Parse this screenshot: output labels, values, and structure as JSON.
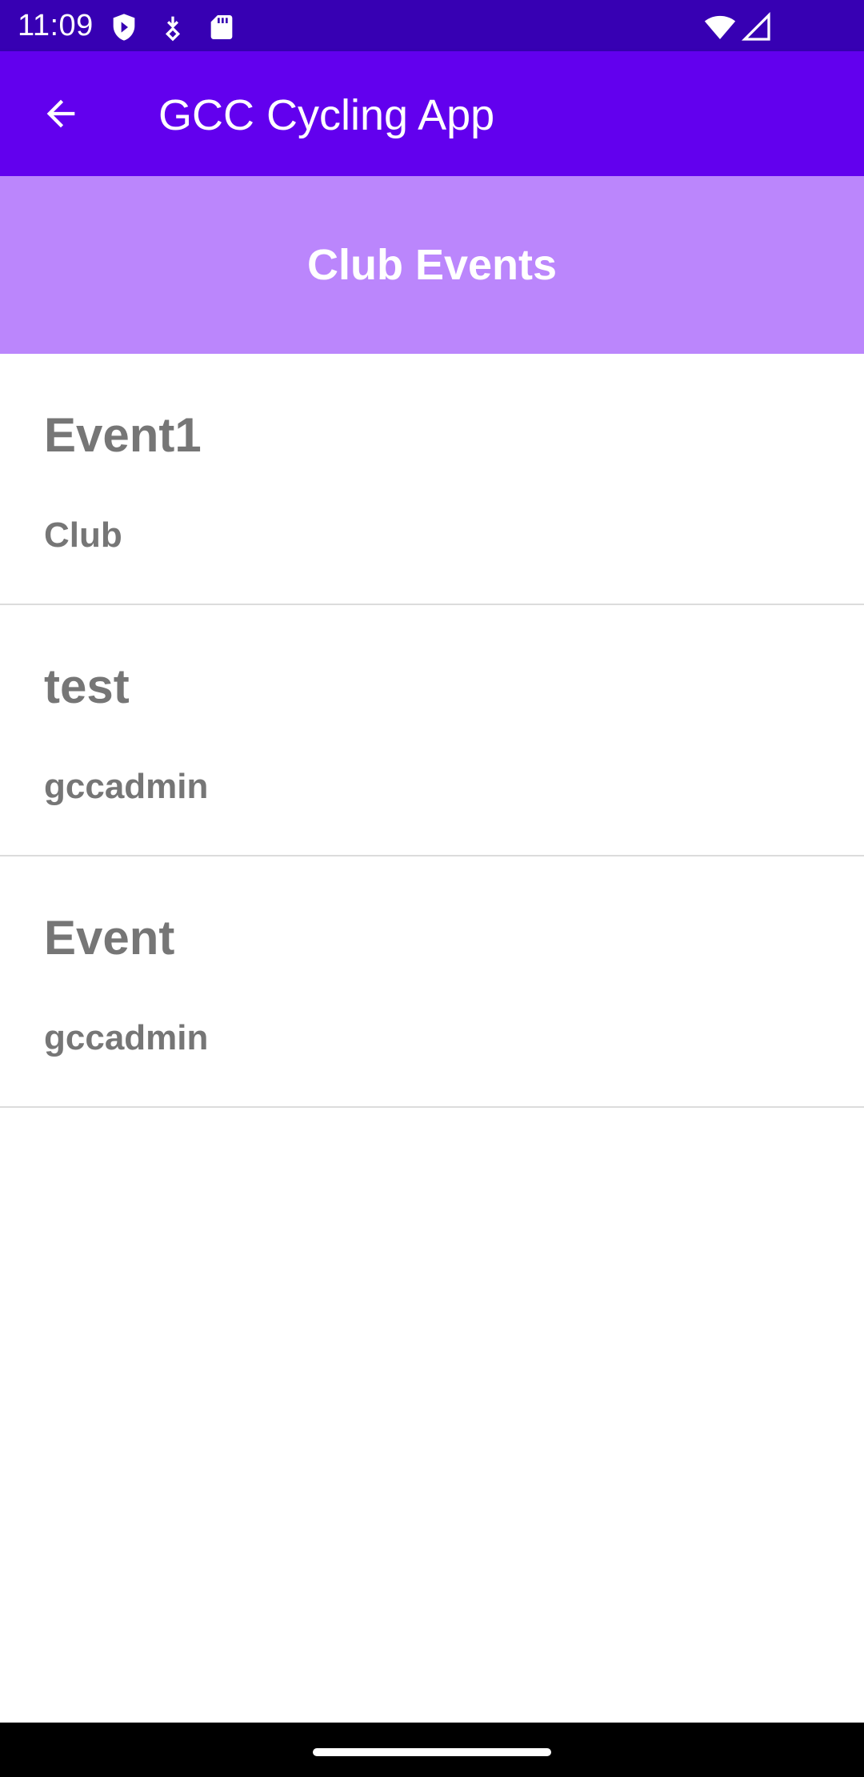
{
  "status_bar": {
    "time": "11:09",
    "icons": [
      "shield-play-icon",
      "download-icon",
      "sd-card-icon",
      "wifi-icon",
      "signal-icon"
    ],
    "background": "#3700b3"
  },
  "app_bar": {
    "back_icon": "arrow-left-icon",
    "title": "GCC Cycling App",
    "background": "#6200ee"
  },
  "section": {
    "title": "Club Events",
    "background": "#bb86fc"
  },
  "events": [
    {
      "name": "Event1",
      "creator": "Club"
    },
    {
      "name": "test",
      "creator": "gccadmin"
    },
    {
      "name": "Event",
      "creator": "gccadmin"
    }
  ],
  "colors": {
    "text_secondary": "#767676",
    "divider": "#dcdcdc"
  }
}
